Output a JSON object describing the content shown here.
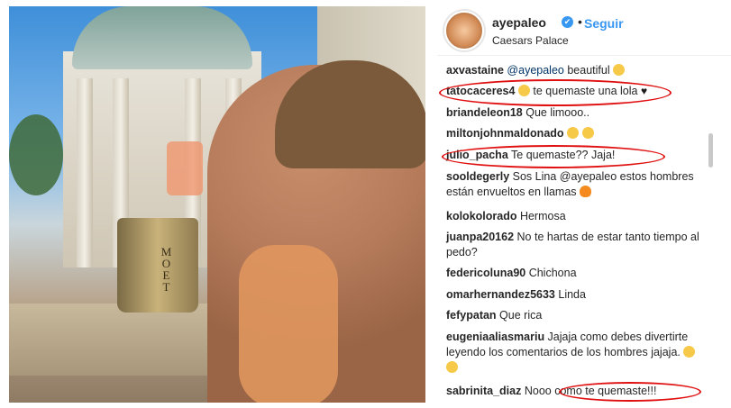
{
  "post": {
    "username": "ayepaleo",
    "verified_badge": "✔",
    "dot": "•",
    "follow_label": "Seguir",
    "location": "Caesars Palace",
    "bucket_text": "MOET"
  },
  "comments": [
    {
      "user": "axvastaine",
      "mention": "@ayepaleo",
      "text": " beautiful ",
      "emoji": "heart-eyes"
    },
    {
      "user": "tatocaceres4",
      "mention": "",
      "text": " te quemaste una lola ",
      "emoji": "surprised",
      "extra": "♥"
    },
    {
      "user": "briandeleon18",
      "mention": "",
      "text": " Que limooo..",
      "emoji": ""
    },
    {
      "user": "miltonjohnmaldonado",
      "mention": "",
      "text": " ",
      "emoji": "heart-eyes-double"
    },
    {
      "user": "julio_pacha",
      "mention": "",
      "text": " Te quemaste?? Jaja!",
      "emoji": ""
    },
    {
      "user": "sooldegerly",
      "mention": "",
      "text": " Sos Lina @ayepaleo estos hombres están envueltos en llamas ",
      "emoji": "fire"
    },
    {
      "user": "kolokolorado",
      "mention": "",
      "text": " Hermosa",
      "emoji": ""
    },
    {
      "user": "juanpa20162",
      "mention": "",
      "text": " No te hartas de estar tanto tiempo al pedo?",
      "emoji": ""
    },
    {
      "user": "federicoluna90",
      "mention": "",
      "text": " Chichona",
      "emoji": ""
    },
    {
      "user": "omarhernandez5633",
      "mention": "",
      "text": " Linda",
      "emoji": ""
    },
    {
      "user": "fefypatan",
      "mention": "",
      "text": " Que rica",
      "emoji": ""
    },
    {
      "user": "eugeniaaliasmariu",
      "mention": "",
      "text": " Jajaja como debes divertirte leyendo los comentarios de los hombres jajaja. ",
      "emoji": "grin-double"
    },
    {
      "user": "sabrinita_diaz",
      "mention": "",
      "text": " Nooo como te quemaste!!!",
      "emoji": ""
    }
  ],
  "colors": {
    "accent": "#3897f0",
    "highlight_oval": "#e01010",
    "text": "#262626"
  }
}
